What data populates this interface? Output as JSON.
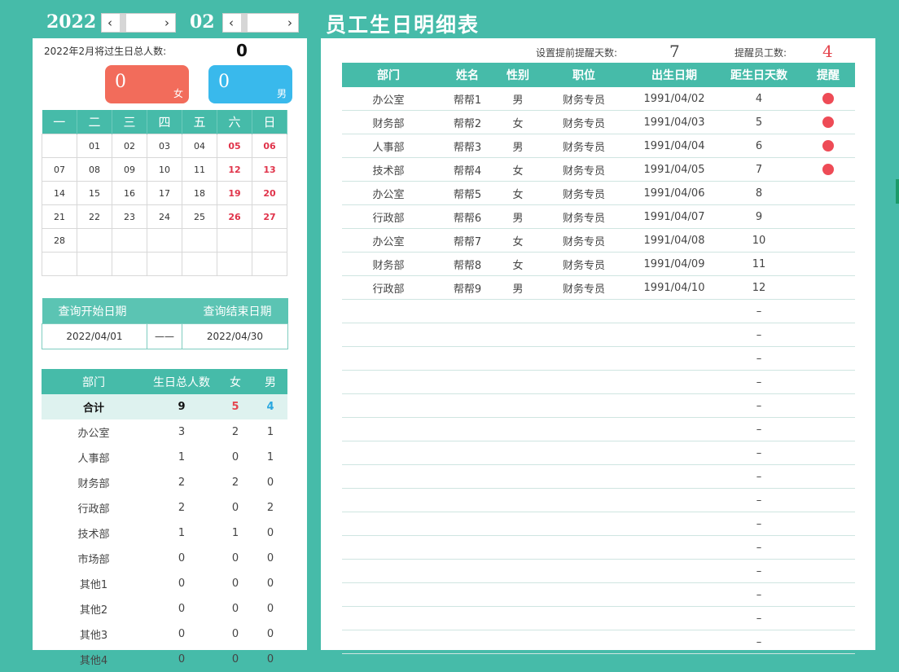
{
  "header": {
    "year": "2022",
    "month": "02",
    "title": "员工生日明细表",
    "year_spinner": {
      "prev": "‹",
      "next": "›"
    },
    "month_spinner": {
      "prev": "‹",
      "next": "›"
    }
  },
  "summary": {
    "label": "2022年2月将过生日总人数:",
    "total": "0",
    "female": {
      "count": "0",
      "label": "女",
      "color": "#f26c5b"
    },
    "male": {
      "count": "0",
      "label": "男",
      "color": "#39b9ec"
    }
  },
  "calendar": {
    "weekdays": [
      "一",
      "二",
      "三",
      "四",
      "五",
      "六",
      "日"
    ],
    "weeks": [
      [
        "",
        "01",
        "02",
        "03",
        "04",
        "05",
        "06"
      ],
      [
        "07",
        "08",
        "09",
        "10",
        "11",
        "12",
        "13"
      ],
      [
        "14",
        "15",
        "16",
        "17",
        "18",
        "19",
        "20"
      ],
      [
        "21",
        "22",
        "23",
        "24",
        "25",
        "26",
        "27"
      ],
      [
        "28",
        "",
        "",
        "",
        "",
        "",
        ""
      ],
      [
        "",
        "",
        "",
        "",
        "",
        "",
        ""
      ]
    ]
  },
  "query": {
    "start_label": "查询开始日期",
    "end_label": "查询结束日期",
    "start": "2022/04/01",
    "sep": "——",
    "end": "2022/04/30"
  },
  "dept_stats": {
    "headers": [
      "部门",
      "生日总人数",
      "女",
      "男"
    ],
    "total": {
      "name": "合计",
      "total": "9",
      "female": "5",
      "male": "4"
    },
    "rows": [
      [
        "办公室",
        "3",
        "2",
        "1"
      ],
      [
        "人事部",
        "1",
        "0",
        "1"
      ],
      [
        "财务部",
        "2",
        "2",
        "0"
      ],
      [
        "行政部",
        "2",
        "0",
        "2"
      ],
      [
        "技术部",
        "1",
        "1",
        "0"
      ],
      [
        "市场部",
        "0",
        "0",
        "0"
      ],
      [
        "其他1",
        "0",
        "0",
        "0"
      ],
      [
        "其他2",
        "0",
        "0",
        "0"
      ],
      [
        "其他3",
        "0",
        "0",
        "0"
      ],
      [
        "其他4",
        "0",
        "0",
        "0"
      ]
    ]
  },
  "settings": {
    "advance_label": "设置提前提醒天数:",
    "advance_days": "7",
    "remind_label": "提醒员工数:",
    "remind_count": "4"
  },
  "employees": {
    "headers": [
      "部门",
      "姓名",
      "性别",
      "职位",
      "出生日期",
      "距生日天数",
      "提醒"
    ],
    "rows": [
      {
        "dept": "办公室",
        "name": "帮帮1",
        "gender": "男",
        "title": "财务专员",
        "birth": "1991/04/02",
        "days": "4",
        "remind": true
      },
      {
        "dept": "财务部",
        "name": "帮帮2",
        "gender": "女",
        "title": "财务专员",
        "birth": "1991/04/03",
        "days": "5",
        "remind": true
      },
      {
        "dept": "人事部",
        "name": "帮帮3",
        "gender": "男",
        "title": "财务专员",
        "birth": "1991/04/04",
        "days": "6",
        "remind": true
      },
      {
        "dept": "技术部",
        "name": "帮帮4",
        "gender": "女",
        "title": "财务专员",
        "birth": "1991/04/05",
        "days": "7",
        "remind": true
      },
      {
        "dept": "办公室",
        "name": "帮帮5",
        "gender": "女",
        "title": "财务专员",
        "birth": "1991/04/06",
        "days": "8",
        "remind": false
      },
      {
        "dept": "行政部",
        "name": "帮帮6",
        "gender": "男",
        "title": "财务专员",
        "birth": "1991/04/07",
        "days": "9",
        "remind": false
      },
      {
        "dept": "办公室",
        "name": "帮帮7",
        "gender": "女",
        "title": "财务专员",
        "birth": "1991/04/08",
        "days": "10",
        "remind": false
      },
      {
        "dept": "财务部",
        "name": "帮帮8",
        "gender": "女",
        "title": "财务专员",
        "birth": "1991/04/09",
        "days": "11",
        "remind": false
      },
      {
        "dept": "行政部",
        "name": "帮帮9",
        "gender": "男",
        "title": "财务专员",
        "birth": "1991/04/10",
        "days": "12",
        "remind": false
      }
    ],
    "empty_marker": "–",
    "empty_rows": 15
  },
  "colors": {
    "accent": "#46bba9",
    "female": "#e5464f",
    "male": "#2aa8e0",
    "weekend": "#e0334a",
    "remind_dot": "#ee4b56"
  }
}
